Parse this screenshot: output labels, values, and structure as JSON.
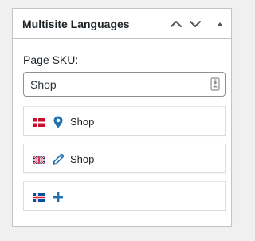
{
  "panel": {
    "title": "Multisite Languages"
  },
  "form": {
    "sku_label": "Page SKU:",
    "sku_value": "Shop"
  },
  "languages": [
    {
      "flag": "denmark-flag",
      "icon": "location-pin-icon",
      "label": "Shop",
      "status": "current"
    },
    {
      "flag": "uk-flag",
      "icon": "pencil-edit-icon",
      "label": "Shop",
      "status": "linked"
    },
    {
      "flag": "iceland-flag",
      "icon": "plus-icon",
      "label": "",
      "status": "add"
    }
  ],
  "colors": {
    "accent": "#2271b1",
    "icon_gray": "#50575e"
  }
}
